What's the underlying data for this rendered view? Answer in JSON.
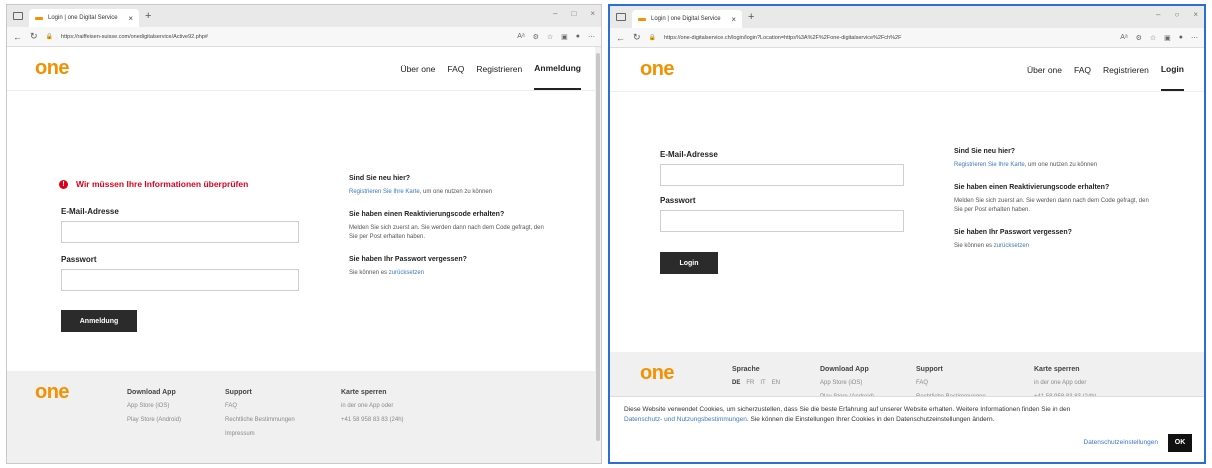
{
  "left": {
    "tab_title": "Login | one Digital Service",
    "url": "https://raiffeisen-suisse.com/onedigitalservice/Active92.php#",
    "logo": "one",
    "nav": [
      "Über one",
      "FAQ",
      "Registrieren",
      "Anmeldung"
    ],
    "error": "Wir müssen Ihre Informationen überprüfen",
    "email_label": "E-Mail-Adresse",
    "password_label": "Passwort",
    "submit": "Anmeldung",
    "side": {
      "new_title": "Sind Sie neu hier?",
      "new_link": "Registrieren Sie Ihre Karte",
      "new_rest": ", um one nutzen zu können",
      "react_title": "Sie haben einen Reaktivierungscode erhalten?",
      "react_text": "Melden Sie sich zuerst an. Sie werden dann nach dem Code gefragt, den Sie per Post erhalten haben.",
      "forgot_title": "Sie haben Ihr Passwort vergessen?",
      "forgot_text": "Sie können es ",
      "forgot_link": "zurücksetzen"
    },
    "footer": {
      "logo": "one",
      "cols": [
        {
          "title": "Download App",
          "items": [
            "App Store (iOS)",
            "Play Store (Android)"
          ]
        },
        {
          "title": "Support",
          "items": [
            "FAQ",
            "Rechtliche Bestimmungen",
            "Impressum"
          ]
        },
        {
          "title": "Karte sperren",
          "items": [
            "in der one App oder",
            "+41 58 958 83 83 (24h)"
          ]
        }
      ]
    }
  },
  "right": {
    "tab_title": "Login | one Digital Service",
    "url": "https://one-digitalservice.ch/login/login?Location=https%3A%2F%2Fone-digitalservice%2Fch%2F",
    "logo": "one",
    "nav": [
      "Über one",
      "FAQ",
      "Registrieren",
      "Login"
    ],
    "email_label": "E-Mail-Adresse",
    "password_label": "Passwort",
    "submit": "Login",
    "side": {
      "new_title": "Sind Sie neu hier?",
      "new_link": "Registrieren Sie Ihre Karte",
      "new_rest": ", um one nutzen zu können",
      "react_title": "Sie haben einen Reaktivierungscode erhalten?",
      "react_text": "Melden Sie sich zuerst an. Sie werden dann nach dem Code gefragt, den Sie per Post erhalten haben.",
      "forgot_title": "Sie haben Ihr Passwort vergessen?",
      "forgot_text": "Sie können es ",
      "forgot_link": "zurücksetzen"
    },
    "footer": {
      "logo": "one",
      "lang_title": "Sprache",
      "langs": [
        "DE",
        "FR",
        "IT",
        "EN"
      ],
      "cols": [
        {
          "title": "Download App",
          "items": [
            "App Store (iOS)",
            "Play Store (Android)"
          ]
        },
        {
          "title": "Support",
          "items": [
            "FAQ",
            "Rechtliche Bestimmungen"
          ]
        },
        {
          "title": "Karte sperren",
          "items": [
            "in der one App oder",
            "+41 58 958 83 83 (24h)"
          ]
        }
      ]
    },
    "cookie": {
      "text1": "Diese Website verwendet Cookies, um sicherzustellen, dass Sie die beste Erfahrung auf unserer Website erhalten. Weitere Informationen finden Sie in den",
      "link": "Datenschutz- und Nutzungsbestimmungen",
      "text2": ". Sie können die Einstellungen Ihrer Cookies in den Datenschutzeinstellungen ändern.",
      "settings": "Datenschutzeinstellungen",
      "ok": "OK"
    }
  }
}
